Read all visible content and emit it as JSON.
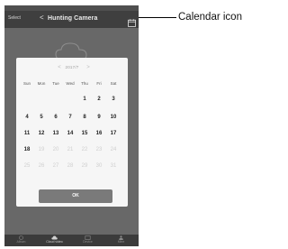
{
  "header": {
    "left_label": "Select",
    "back_glyph": "<",
    "title": "Hunting Camera",
    "calendar_icon": "calendar-icon"
  },
  "calendar": {
    "prev_glyph": "<",
    "next_glyph": ">",
    "month_label": "2017/7",
    "weekdays": [
      "Sun",
      "Mon",
      "Tue",
      "Wed",
      "Thu",
      "Fri",
      "Sat"
    ],
    "weeks": [
      [
        "",
        "",
        "",
        "",
        "1",
        "2",
        "3"
      ],
      [
        "4",
        "5",
        "6",
        "7",
        "8",
        "9",
        "10"
      ],
      [
        "11",
        "12",
        "13",
        "14",
        "15",
        "16",
        "17"
      ],
      [
        "18",
        "19",
        "20",
        "21",
        "22",
        "23",
        "24"
      ],
      [
        "25",
        "26",
        "27",
        "28",
        "29",
        "30",
        "31"
      ]
    ],
    "ok_label": "OK"
  },
  "tabbar": {
    "items": [
      {
        "label": "Album",
        "icon": "album-icon"
      },
      {
        "label": "Cloud video",
        "icon": "cloud-icon"
      },
      {
        "label": "Device",
        "icon": "device-icon"
      },
      {
        "label": "Mine",
        "icon": "person-icon"
      }
    ]
  },
  "callout": {
    "label": "Calendar icon"
  }
}
